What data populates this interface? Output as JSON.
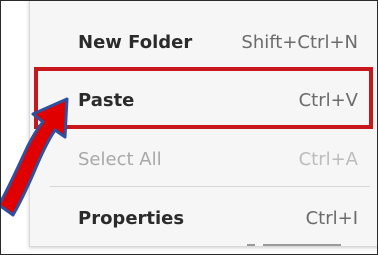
{
  "context_menu": {
    "items": [
      {
        "label": "New Folder",
        "shortcut": "Shift+Ctrl+N"
      },
      {
        "label": "Paste",
        "shortcut": "Ctrl+V"
      },
      {
        "label": "Select All",
        "shortcut": "Ctrl+A"
      },
      {
        "label": "Properties",
        "shortcut": "Ctrl+I"
      }
    ]
  },
  "annotation": {
    "highlight_color": "#c8161d",
    "arrow_fill": "#e00000",
    "arrow_outline": "#2f4f9f"
  }
}
